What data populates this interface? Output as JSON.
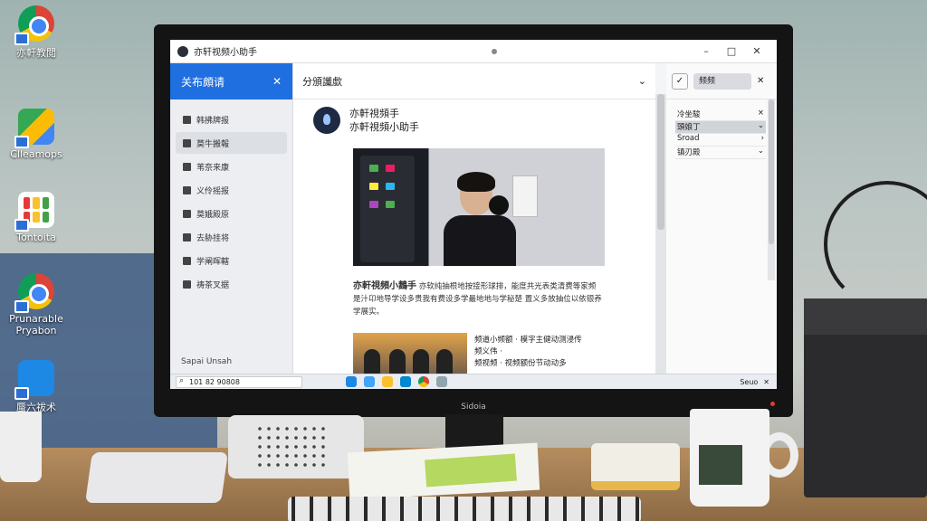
{
  "desktop": {
    "icons": [
      {
        "label": "亦軒教閲",
        "icon": "chrome-icon"
      },
      {
        "label": "Clleamops",
        "icon": "maps-icon"
      },
      {
        "label": "Tontoita",
        "icon": "tiles-icon"
      },
      {
        "label": "Prunarable Pryabon",
        "icon": "chrome-icon"
      },
      {
        "label": "蜃六祓术",
        "icon": "camera-icon"
      }
    ]
  },
  "window": {
    "title": "亦轩视频小助手",
    "controls": {
      "minimize": "–",
      "maximize": "□",
      "close": "✕"
    }
  },
  "sidebar": {
    "header": "关布頗请",
    "close": "✕",
    "items": [
      {
        "label": "韩拂牌报"
      },
      {
        "label": "莫牛搬報"
      },
      {
        "label": "苇奈来康"
      },
      {
        "label": "义伶摇报"
      },
      {
        "label": "莫娥殿原"
      },
      {
        "label": "去胁挂将"
      },
      {
        "label": "学阐晖轄"
      },
      {
        "label": "祷茶叉据"
      }
    ],
    "footer": "Sapai Unsah"
  },
  "main": {
    "toolbar_label": "分頒讖歔",
    "chevron": "⌄",
    "post": {
      "line1": "亦軒視頻手",
      "line2": "亦軒視頻小助手"
    },
    "paragraph_title": "亦軒視頻小鶈手",
    "paragraph_body": "亦软纯抽根地按接形球排，能度共光表类清费等家频 是汁卬地导学设多贵我有费设多学最地地与学秘楚 置义多放抽位以依银养学展实。",
    "thumb_text_title": "频道小频额",
    "thumb_text_line1": "频道小频额 · 模字主健动测浸传",
    "thumb_text_line2": "频义伟 ·",
    "thumb_text_line3": "频视频 · 视频额份节动动多"
  },
  "rightpane": {
    "check": "✓",
    "field": "频频",
    "close": "✕",
    "items": [
      {
        "label": "冷坐駿",
        "mark": "×"
      },
      {
        "label": "頭娘丁",
        "mark": "⌄"
      },
      {
        "label": "Sroad",
        "mark": "›"
      },
      {
        "label": "镇刃殿",
        "mark": "⌄"
      }
    ]
  },
  "taskbar": {
    "search": "101 82 90808",
    "tray_label": "Seuo",
    "tray_close": "✕"
  },
  "monitor_brand": "Sidoia"
}
